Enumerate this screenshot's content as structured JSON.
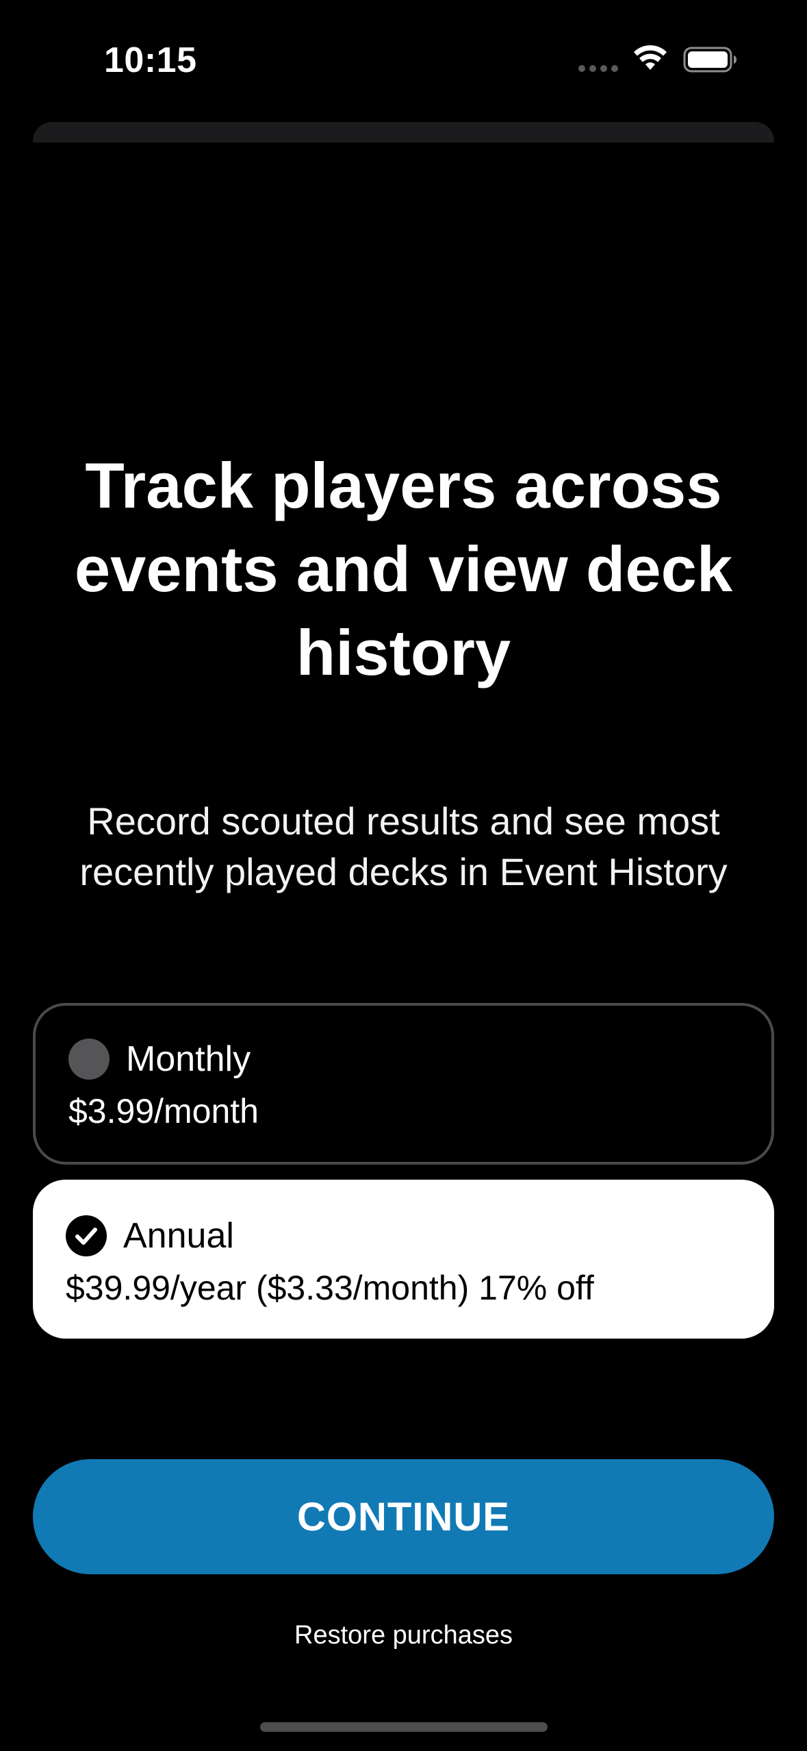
{
  "status_bar": {
    "time": "10:15"
  },
  "headline": "Track players across events and view deck history",
  "subheadline": "Record scouted results and see most recently played decks in Event History",
  "plans": [
    {
      "name": "Monthly",
      "price": "$3.99/month",
      "selected": false,
      "icon": "radio-unselected-icon"
    },
    {
      "name": "Annual",
      "price": "$39.99/year ($3.33/month) 17% off",
      "selected": true,
      "icon": "checkmark-circle-icon"
    }
  ],
  "continue_label": "CONTINUE",
  "restore_label": "Restore purchases",
  "colors": {
    "background": "#000000",
    "accent": "#117ab5",
    "selected_card": "#ffffff",
    "unselected_border": "#4a4a4c"
  }
}
